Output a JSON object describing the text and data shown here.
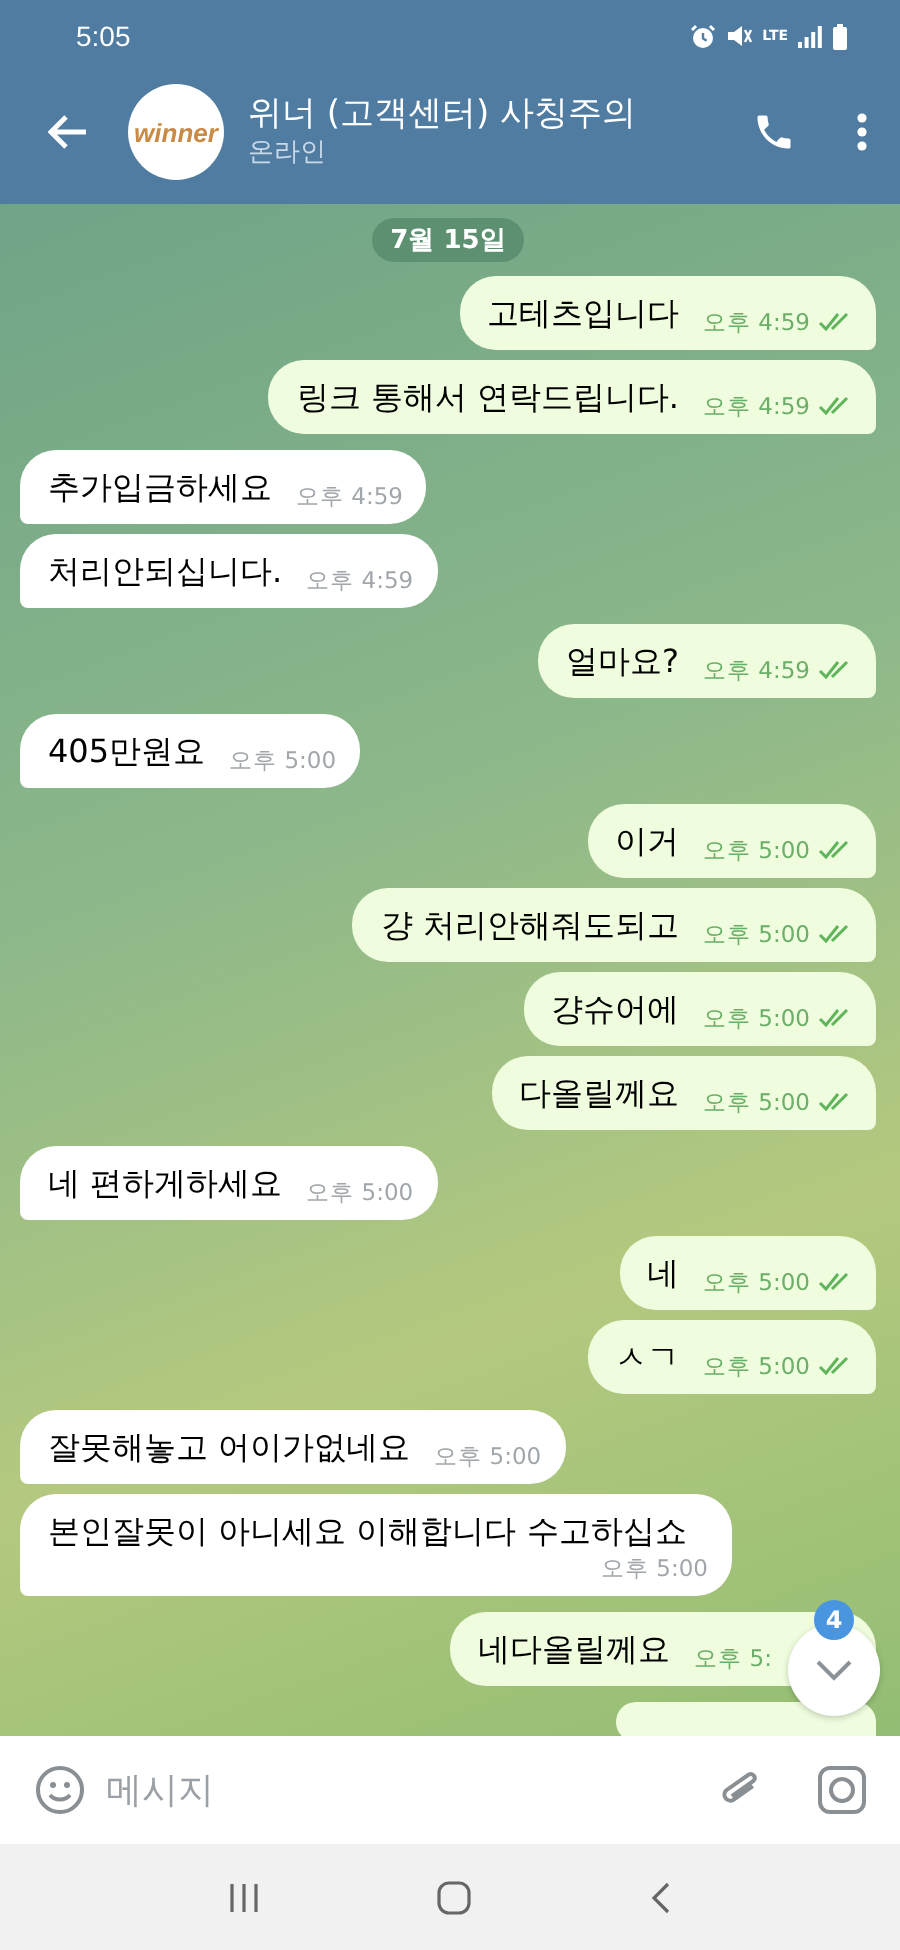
{
  "status_bar": {
    "time": "5:05",
    "network": "LTE"
  },
  "header": {
    "avatar_text": "winner",
    "title": "위너 (고객센터) 사칭주의",
    "subtitle": "온라인"
  },
  "date_pill": "7월 15일",
  "messages": [
    {
      "kind": "out",
      "text": "고테츠입니다",
      "time": "오후 4:59",
      "ticks": true
    },
    {
      "kind": "out",
      "text": "링크 통해서 연락드립니다.",
      "time": "오후 4:59",
      "ticks": true
    },
    {
      "kind": "in",
      "text": "추가입금하세요",
      "time": "오후 4:59"
    },
    {
      "kind": "in",
      "text": "처리안되십니다.",
      "time": "오후 4:59"
    },
    {
      "kind": "out",
      "text": "얼마요?",
      "time": "오후 4:59",
      "ticks": true
    },
    {
      "kind": "in",
      "text": "405만원요",
      "time": "오후 5:00"
    },
    {
      "kind": "out",
      "text": "이거",
      "time": "오후 5:00",
      "ticks": true
    },
    {
      "kind": "out",
      "text": "걍 처리안해줘도되고",
      "time": "오후 5:00",
      "ticks": true
    },
    {
      "kind": "out",
      "text": "걍슈어에",
      "time": "오후 5:00",
      "ticks": true
    },
    {
      "kind": "out",
      "text": "다올릴께요",
      "time": "오후 5:00",
      "ticks": true
    },
    {
      "kind": "in",
      "text": "네 편하게하세요",
      "time": "오후 5:00"
    },
    {
      "kind": "out",
      "text": "네",
      "time": "오후 5:00",
      "ticks": true
    },
    {
      "kind": "out",
      "text": "ㅅㄱ",
      "time": "오후 5:00",
      "ticks": true
    },
    {
      "kind": "in",
      "text": "잘못해놓고 어이가없네요",
      "time": "오후 5:00"
    },
    {
      "kind": "in",
      "text": "본인잘못이 아니세요 이해합니다 수고하십쇼",
      "time": "오후 5:00"
    },
    {
      "kind": "out",
      "text": "네다올릴께요",
      "time": "오후 5:",
      "ticks": false
    },
    {
      "kind": "cut"
    }
  ],
  "scroll_button": {
    "badge": "4"
  },
  "composer": {
    "placeholder": "메시지"
  }
}
